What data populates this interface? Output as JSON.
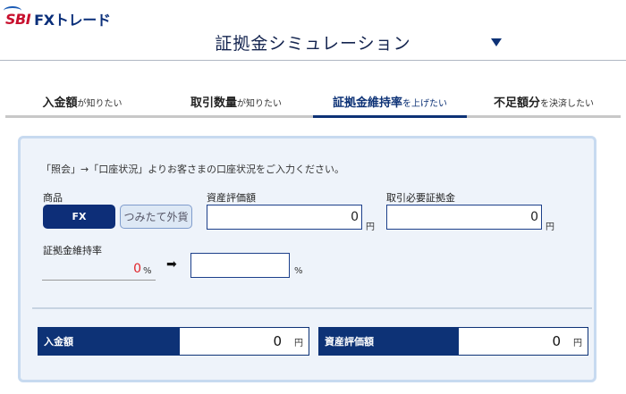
{
  "header": {
    "logo_sbi": "SBI",
    "logo_fx": "FXトレード",
    "title": "証拠金シミュレーション"
  },
  "tabs": [
    {
      "main": "入金額",
      "sub": "が知りたい",
      "active": false
    },
    {
      "main": "取引数量",
      "sub": "が知りたい",
      "active": false
    },
    {
      "main": "証拠金維持率",
      "sub": "を上げたい",
      "active": true
    },
    {
      "main": "不足額分",
      "sub": "を決済したい",
      "active": false
    }
  ],
  "form": {
    "instruction": "「照会」→「口座状況」よりお客さまの口座状況をご入力ください。",
    "product_label": "商品",
    "product_options": [
      "FX",
      "つみたて外貨"
    ],
    "asset_label": "資産評価額",
    "asset_value": "0",
    "asset_unit": "円",
    "margin_label": "取引必要証拠金",
    "margin_value": "0",
    "margin_unit": "円",
    "ratio_label": "証拠金維持率",
    "ratio_current": "0",
    "ratio_unit": "%",
    "arrow": "➡",
    "ratio_target": "",
    "ratio_target_unit": "%"
  },
  "results": [
    {
      "label": "入金額",
      "value": "0",
      "unit": "円"
    },
    {
      "label": "資産評価額",
      "value": "0",
      "unit": "円"
    }
  ],
  "colors": {
    "brand_navy": "#0d3276",
    "brand_red": "#c8102e",
    "panel_bg": "#eef3fa",
    "negative_red": "#e0242a"
  }
}
